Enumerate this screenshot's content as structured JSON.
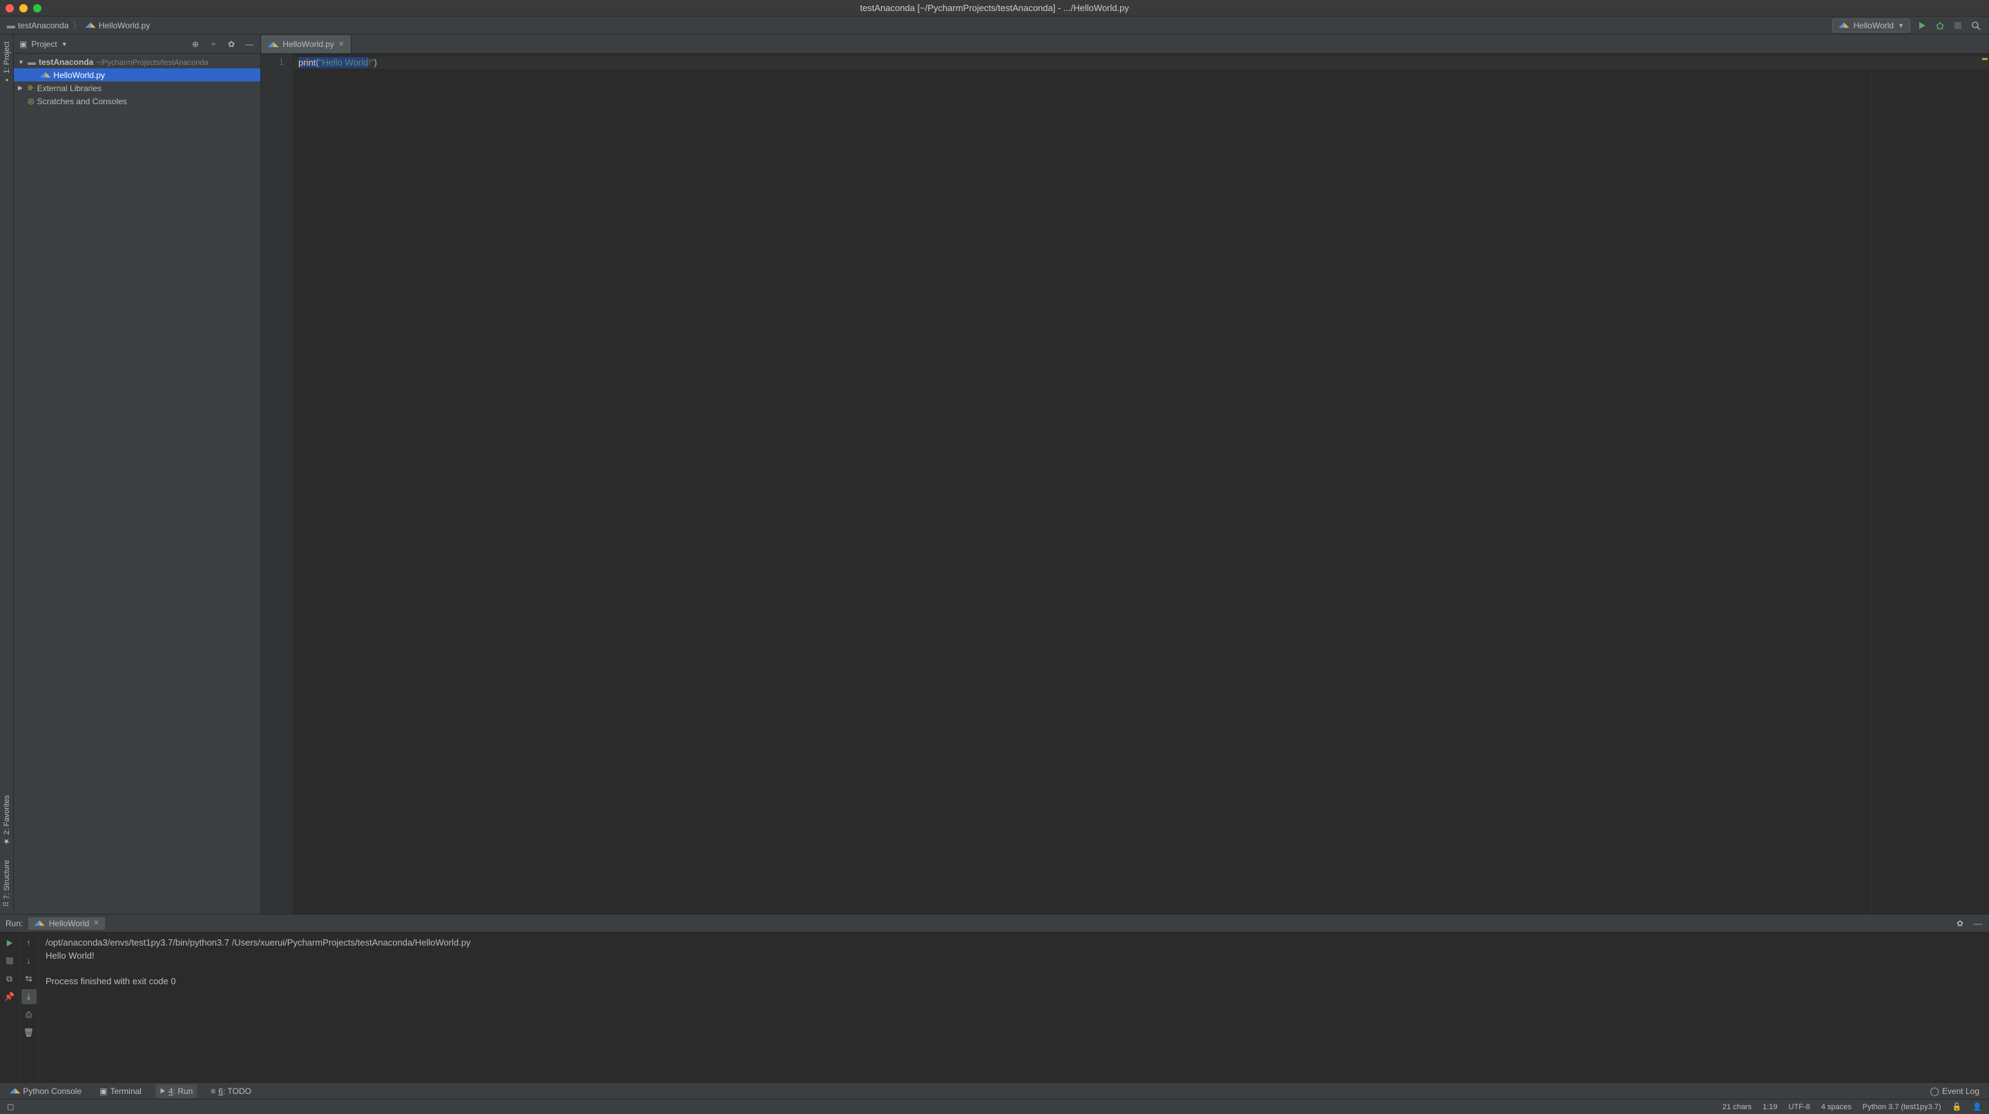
{
  "titlebar": {
    "title": "testAnaconda [~/PycharmProjects/testAnaconda] - .../HelloWorld.py"
  },
  "breadcrumb": {
    "project": "testAnaconda",
    "file": "HelloWorld.py"
  },
  "toolbar": {
    "runConfig": "HelloWorld"
  },
  "projectPanel": {
    "title": "Project",
    "root": {
      "name": "testAnaconda",
      "path": "~/PycharmProjects/testAnaconda"
    },
    "file": "HelloWorld.py",
    "externalLibs": "External Libraries",
    "scratches": "Scratches and Consoles"
  },
  "editor": {
    "tab": "HelloWorld.py",
    "lineNum": "1",
    "code": {
      "func": "print",
      "open": "(",
      "strOpen": "\"",
      "strSel": "Hello World",
      "strRest": "!\"",
      "close": ")"
    }
  },
  "runPanel": {
    "label": "Run:",
    "tab": "HelloWorld",
    "output": {
      "cmd": "/opt/anaconda3/envs/test1py3.7/bin/python3.7 /Users/xuerui/PycharmProjects/testAnaconda/HelloWorld.py",
      "out": "Hello World!",
      "finish": "Process finished with exit code 0"
    }
  },
  "bottomTabs": {
    "pythonConsole": "Python Console",
    "terminal": "Terminal",
    "runPrefix": "4",
    "runLabel": ": Run",
    "todoPrefix": "6",
    "todoLabel": ": TODO",
    "eventLog": "Event Log"
  },
  "statusBar": {
    "chars": "21 chars",
    "pos": "1:19",
    "encoding": "UTF-8",
    "indent": "4 spaces",
    "python": "Python 3.7 (test1py3.7)"
  }
}
